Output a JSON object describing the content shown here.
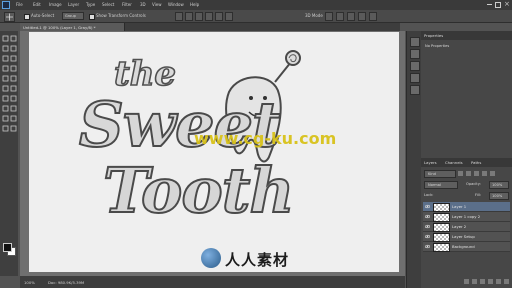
{
  "menubar": {
    "items": [
      "File",
      "Edit",
      "Image",
      "Layer",
      "Type",
      "Select",
      "Filter",
      "3D",
      "View",
      "Window",
      "Help"
    ]
  },
  "options": {
    "auto_select_label": "Auto-Select",
    "auto_select_value": "Group",
    "show_transform_label": "Show Transform Controls",
    "mode_label": "3D Mode"
  },
  "document": {
    "tab_title": "Untitled-1 @ 100% (Layer 1, Gray/8) *",
    "artwork_words": [
      "the",
      "Sweet",
      "Tooth"
    ]
  },
  "watermark": {
    "url_text": "www.cg-ku.com",
    "brand_text": "人人素材"
  },
  "statusbar": {
    "zoom": "100%",
    "doc_info": "Doc: 980.9K/5.39M"
  },
  "properties_panel": {
    "tab_label": "Properties",
    "body_text": "No Properties"
  },
  "layers_panel": {
    "tabs": [
      "Layers",
      "Channels",
      "Paths"
    ],
    "kind_label": "Kind",
    "blend_mode": "Normal",
    "opacity_label": "Opacity:",
    "opacity_value": "100%",
    "lock_label": "Lock:",
    "fill_label": "Fill:",
    "fill_value": "100%",
    "layers": [
      {
        "name": "Layer 1",
        "selected": true
      },
      {
        "name": "Layer 1 copy 2",
        "selected": false
      },
      {
        "name": "Layer 2",
        "selected": false
      },
      {
        "name": "Layer Setup",
        "selected": false
      },
      {
        "name": "Background",
        "selected": false
      }
    ]
  },
  "colors": {
    "ui_dark": "#3a3a3a",
    "ui_mid": "#535353",
    "canvas": "#efefef",
    "selection": "#5b6f8a",
    "watermark_blue": "#2a5b8a",
    "watermark_yellow": "#d8c21a"
  }
}
